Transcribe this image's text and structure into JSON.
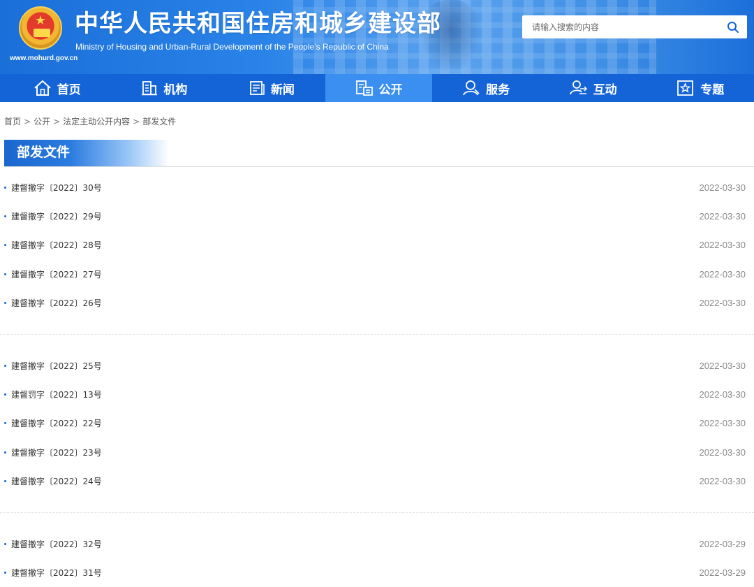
{
  "header": {
    "site_title": "中华人民共和国住房和城乡建设部",
    "site_subtitle": "Ministry of Housing and Urban-Rural Development of the People’s Republic of China",
    "site_url": "www.mohurd.gov.cn",
    "search": {
      "placeholder": "请输入搜索的内容"
    }
  },
  "nav": {
    "items": [
      {
        "label": "首页",
        "icon": "home-icon"
      },
      {
        "label": "机构",
        "icon": "building-icon"
      },
      {
        "label": "新闻",
        "icon": "news-icon"
      },
      {
        "label": "公开",
        "icon": "disclosure-icon",
        "active": true
      },
      {
        "label": "服务",
        "icon": "service-icon"
      },
      {
        "label": "互动",
        "icon": "interaction-icon"
      },
      {
        "label": "专题",
        "icon": "topic-icon"
      }
    ]
  },
  "breadcrumb": {
    "items": [
      "首页",
      "公开",
      "法定主动公开内容",
      "部发文件"
    ],
    "separator": ">"
  },
  "section": {
    "title": "部发文件"
  },
  "list": {
    "groups": [
      [
        {
          "title": "建督撤字〔2022〕30号",
          "date": "2022-03-30"
        },
        {
          "title": "建督撤字〔2022〕29号",
          "date": "2022-03-30"
        },
        {
          "title": "建督撤字〔2022〕28号",
          "date": "2022-03-30"
        },
        {
          "title": "建督撤字〔2022〕27号",
          "date": "2022-03-30"
        },
        {
          "title": "建督撤字〔2022〕26号",
          "date": "2022-03-30"
        }
      ],
      [
        {
          "title": "建督撤字〔2022〕25号",
          "date": "2022-03-30"
        },
        {
          "title": "建督罚字〔2022〕13号",
          "date": "2022-03-30"
        },
        {
          "title": "建督撤字〔2022〕22号",
          "date": "2022-03-30"
        },
        {
          "title": "建督撤字〔2022〕23号",
          "date": "2022-03-30"
        },
        {
          "title": "建督撤字〔2022〕24号",
          "date": "2022-03-30"
        }
      ],
      [
        {
          "title": "建督撤字〔2022〕32号",
          "date": "2022-03-29"
        },
        {
          "title": "建督撤字〔2022〕31号",
          "date": "2022-03-29"
        }
      ]
    ]
  },
  "colors": {
    "nav_bg": "#1464d8",
    "nav_active": "#3a8ff0",
    "accent": "#1a67cf"
  }
}
